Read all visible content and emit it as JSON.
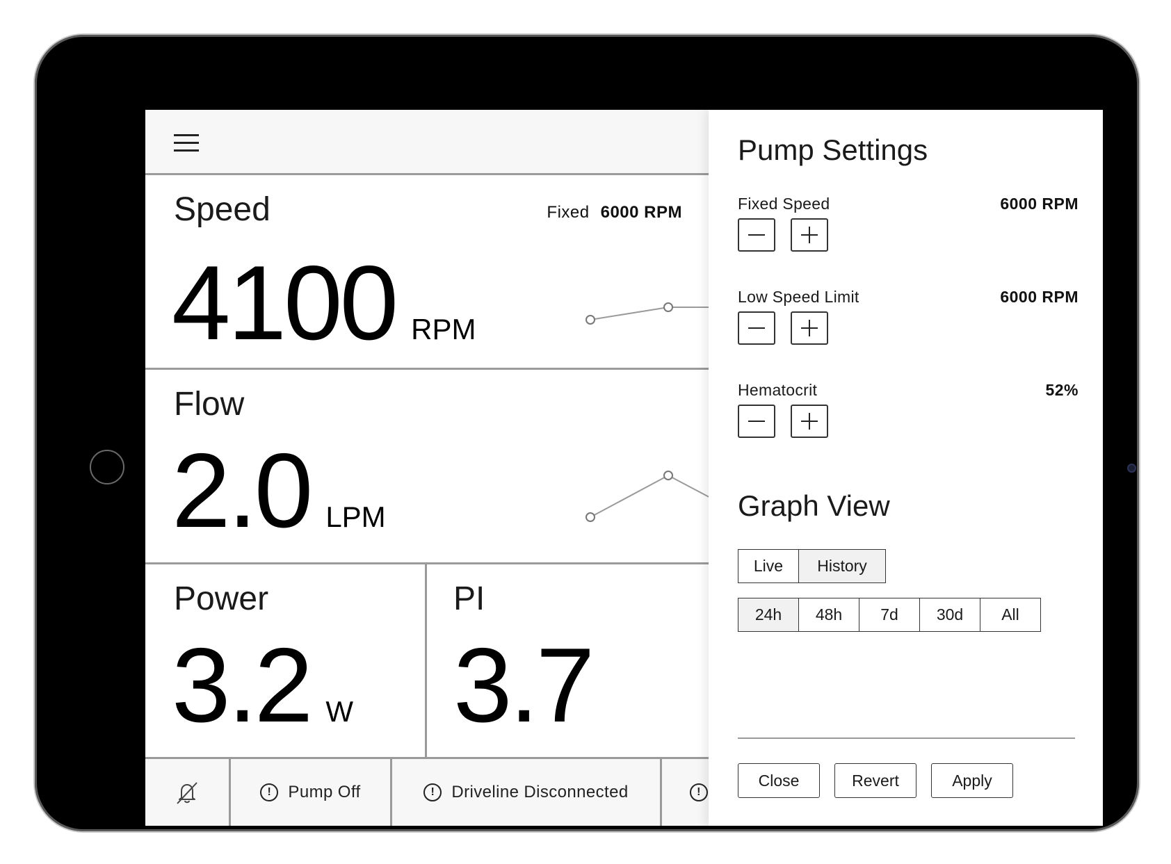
{
  "main": {
    "menu_icon": "hamburger-menu-icon",
    "speed": {
      "title": "Speed",
      "value": "4100",
      "unit": "RPM",
      "setpoint_label": "Fixed",
      "setpoint_value": "6000 RPM"
    },
    "flow": {
      "title": "Flow",
      "value": "2.0",
      "unit": "LPM"
    },
    "power": {
      "title": "Power",
      "value": "3.2",
      "unit": "W"
    },
    "pi": {
      "title": "PI",
      "value": "3.7"
    },
    "sparkline_color": "#9a9a9a"
  },
  "status_bar": {
    "mute_icon": "bell-slash-icon",
    "alerts": [
      {
        "icon": "alert-circle-icon",
        "label": "Pump Off"
      },
      {
        "icon": "alert-circle-icon",
        "label": "Driveline Disconnected"
      },
      {
        "icon": "alert-circle-icon",
        "label": ""
      }
    ]
  },
  "drawer": {
    "title": "Pump Settings",
    "settings": [
      {
        "label": "Fixed Speed",
        "value": "6000 RPM"
      },
      {
        "label": "Low Speed Limit",
        "value": "6000 RPM"
      },
      {
        "label": "Hematocrit",
        "value": "52%"
      }
    ],
    "graph_view": {
      "title": "Graph View",
      "modes": [
        {
          "label": "Live",
          "selected": false
        },
        {
          "label": "History",
          "selected": true
        }
      ],
      "ranges": [
        {
          "label": "24h",
          "selected": true
        },
        {
          "label": "48h",
          "selected": false
        },
        {
          "label": "7d",
          "selected": false
        },
        {
          "label": "30d",
          "selected": false
        },
        {
          "label": "All",
          "selected": false
        }
      ]
    },
    "buttons": {
      "close": "Close",
      "revert": "Revert",
      "apply": "Apply"
    }
  }
}
